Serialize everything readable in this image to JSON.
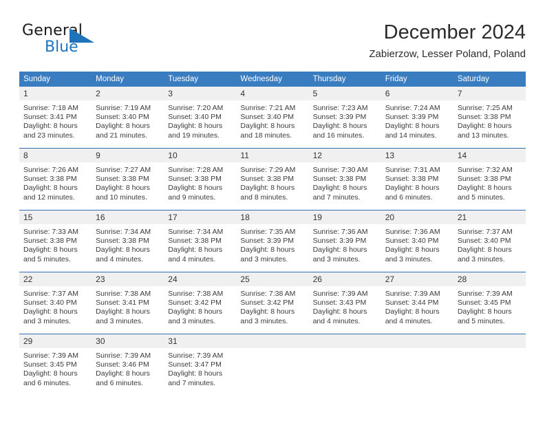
{
  "logo": {
    "word_top": "General",
    "word_bottom": "Blue",
    "accent_color": "#1e74bb"
  },
  "header": {
    "title": "December 2024",
    "subtitle": "Zabierzow, Lesser Poland, Poland"
  },
  "colors": {
    "header_row_bg": "#3a7cc0",
    "header_row_text": "#ffffff",
    "daynum_bg": "#f0f0f0",
    "row_separator": "#2f6fb0"
  },
  "weekdays": [
    "Sunday",
    "Monday",
    "Tuesday",
    "Wednesday",
    "Thursday",
    "Friday",
    "Saturday"
  ],
  "labels": {
    "sunrise_prefix": "Sunrise:",
    "sunset_prefix": "Sunset:",
    "daylight_prefix": "Daylight:"
  },
  "weeks": [
    [
      {
        "day": "1",
        "sunrise": "Sunrise: 7:18 AM",
        "sunset": "Sunset: 3:41 PM",
        "daylight1": "Daylight: 8 hours",
        "daylight2": "and 23 minutes."
      },
      {
        "day": "2",
        "sunrise": "Sunrise: 7:19 AM",
        "sunset": "Sunset: 3:40 PM",
        "daylight1": "Daylight: 8 hours",
        "daylight2": "and 21 minutes."
      },
      {
        "day": "3",
        "sunrise": "Sunrise: 7:20 AM",
        "sunset": "Sunset: 3:40 PM",
        "daylight1": "Daylight: 8 hours",
        "daylight2": "and 19 minutes."
      },
      {
        "day": "4",
        "sunrise": "Sunrise: 7:21 AM",
        "sunset": "Sunset: 3:40 PM",
        "daylight1": "Daylight: 8 hours",
        "daylight2": "and 18 minutes."
      },
      {
        "day": "5",
        "sunrise": "Sunrise: 7:23 AM",
        "sunset": "Sunset: 3:39 PM",
        "daylight1": "Daylight: 8 hours",
        "daylight2": "and 16 minutes."
      },
      {
        "day": "6",
        "sunrise": "Sunrise: 7:24 AM",
        "sunset": "Sunset: 3:39 PM",
        "daylight1": "Daylight: 8 hours",
        "daylight2": "and 14 minutes."
      },
      {
        "day": "7",
        "sunrise": "Sunrise: 7:25 AM",
        "sunset": "Sunset: 3:38 PM",
        "daylight1": "Daylight: 8 hours",
        "daylight2": "and 13 minutes."
      }
    ],
    [
      {
        "day": "8",
        "sunrise": "Sunrise: 7:26 AM",
        "sunset": "Sunset: 3:38 PM",
        "daylight1": "Daylight: 8 hours",
        "daylight2": "and 12 minutes."
      },
      {
        "day": "9",
        "sunrise": "Sunrise: 7:27 AM",
        "sunset": "Sunset: 3:38 PM",
        "daylight1": "Daylight: 8 hours",
        "daylight2": "and 10 minutes."
      },
      {
        "day": "10",
        "sunrise": "Sunrise: 7:28 AM",
        "sunset": "Sunset: 3:38 PM",
        "daylight1": "Daylight: 8 hours",
        "daylight2": "and 9 minutes."
      },
      {
        "day": "11",
        "sunrise": "Sunrise: 7:29 AM",
        "sunset": "Sunset: 3:38 PM",
        "daylight1": "Daylight: 8 hours",
        "daylight2": "and 8 minutes."
      },
      {
        "day": "12",
        "sunrise": "Sunrise: 7:30 AM",
        "sunset": "Sunset: 3:38 PM",
        "daylight1": "Daylight: 8 hours",
        "daylight2": "and 7 minutes."
      },
      {
        "day": "13",
        "sunrise": "Sunrise: 7:31 AM",
        "sunset": "Sunset: 3:38 PM",
        "daylight1": "Daylight: 8 hours",
        "daylight2": "and 6 minutes."
      },
      {
        "day": "14",
        "sunrise": "Sunrise: 7:32 AM",
        "sunset": "Sunset: 3:38 PM",
        "daylight1": "Daylight: 8 hours",
        "daylight2": "and 5 minutes."
      }
    ],
    [
      {
        "day": "15",
        "sunrise": "Sunrise: 7:33 AM",
        "sunset": "Sunset: 3:38 PM",
        "daylight1": "Daylight: 8 hours",
        "daylight2": "and 5 minutes."
      },
      {
        "day": "16",
        "sunrise": "Sunrise: 7:34 AM",
        "sunset": "Sunset: 3:38 PM",
        "daylight1": "Daylight: 8 hours",
        "daylight2": "and 4 minutes."
      },
      {
        "day": "17",
        "sunrise": "Sunrise: 7:34 AM",
        "sunset": "Sunset: 3:38 PM",
        "daylight1": "Daylight: 8 hours",
        "daylight2": "and 4 minutes."
      },
      {
        "day": "18",
        "sunrise": "Sunrise: 7:35 AM",
        "sunset": "Sunset: 3:39 PM",
        "daylight1": "Daylight: 8 hours",
        "daylight2": "and 3 minutes."
      },
      {
        "day": "19",
        "sunrise": "Sunrise: 7:36 AM",
        "sunset": "Sunset: 3:39 PM",
        "daylight1": "Daylight: 8 hours",
        "daylight2": "and 3 minutes."
      },
      {
        "day": "20",
        "sunrise": "Sunrise: 7:36 AM",
        "sunset": "Sunset: 3:40 PM",
        "daylight1": "Daylight: 8 hours",
        "daylight2": "and 3 minutes."
      },
      {
        "day": "21",
        "sunrise": "Sunrise: 7:37 AM",
        "sunset": "Sunset: 3:40 PM",
        "daylight1": "Daylight: 8 hours",
        "daylight2": "and 3 minutes."
      }
    ],
    [
      {
        "day": "22",
        "sunrise": "Sunrise: 7:37 AM",
        "sunset": "Sunset: 3:40 PM",
        "daylight1": "Daylight: 8 hours",
        "daylight2": "and 3 minutes."
      },
      {
        "day": "23",
        "sunrise": "Sunrise: 7:38 AM",
        "sunset": "Sunset: 3:41 PM",
        "daylight1": "Daylight: 8 hours",
        "daylight2": "and 3 minutes."
      },
      {
        "day": "24",
        "sunrise": "Sunrise: 7:38 AM",
        "sunset": "Sunset: 3:42 PM",
        "daylight1": "Daylight: 8 hours",
        "daylight2": "and 3 minutes."
      },
      {
        "day": "25",
        "sunrise": "Sunrise: 7:38 AM",
        "sunset": "Sunset: 3:42 PM",
        "daylight1": "Daylight: 8 hours",
        "daylight2": "and 3 minutes."
      },
      {
        "day": "26",
        "sunrise": "Sunrise: 7:39 AM",
        "sunset": "Sunset: 3:43 PM",
        "daylight1": "Daylight: 8 hours",
        "daylight2": "and 4 minutes."
      },
      {
        "day": "27",
        "sunrise": "Sunrise: 7:39 AM",
        "sunset": "Sunset: 3:44 PM",
        "daylight1": "Daylight: 8 hours",
        "daylight2": "and 4 minutes."
      },
      {
        "day": "28",
        "sunrise": "Sunrise: 7:39 AM",
        "sunset": "Sunset: 3:45 PM",
        "daylight1": "Daylight: 8 hours",
        "daylight2": "and 5 minutes."
      }
    ],
    [
      {
        "day": "29",
        "sunrise": "Sunrise: 7:39 AM",
        "sunset": "Sunset: 3:45 PM",
        "daylight1": "Daylight: 8 hours",
        "daylight2": "and 6 minutes."
      },
      {
        "day": "30",
        "sunrise": "Sunrise: 7:39 AM",
        "sunset": "Sunset: 3:46 PM",
        "daylight1": "Daylight: 8 hours",
        "daylight2": "and 6 minutes."
      },
      {
        "day": "31",
        "sunrise": "Sunrise: 7:39 AM",
        "sunset": "Sunset: 3:47 PM",
        "daylight1": "Daylight: 8 hours",
        "daylight2": "and 7 minutes."
      },
      {
        "day": "",
        "sunrise": "",
        "sunset": "",
        "daylight1": "",
        "daylight2": ""
      },
      {
        "day": "",
        "sunrise": "",
        "sunset": "",
        "daylight1": "",
        "daylight2": ""
      },
      {
        "day": "",
        "sunrise": "",
        "sunset": "",
        "daylight1": "",
        "daylight2": ""
      },
      {
        "day": "",
        "sunrise": "",
        "sunset": "",
        "daylight1": "",
        "daylight2": ""
      }
    ]
  ]
}
